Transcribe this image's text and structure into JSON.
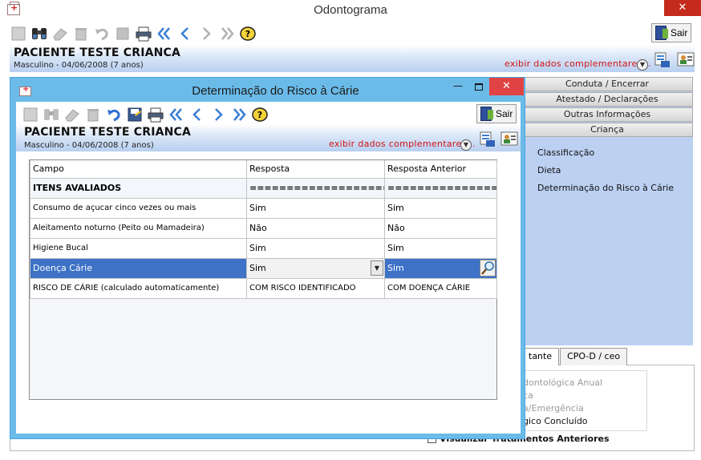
{
  "main": {
    "title": "Odontograma",
    "close_label": "✕",
    "sair_label": "Sair",
    "patient_name": "PACIENTE TESTE CRIANCA",
    "patient_info": "Masculino - 04/06/2008 (7 anos)",
    "exibir_label": "exibir dados complementares..."
  },
  "right_panel": {
    "tabs": [
      "Conduta / Encerrar",
      "Atestado / Declarações",
      "Outras Informações",
      "Criança"
    ],
    "items": [
      "Classificação",
      "Dieta",
      "Determinação do Risco à Cárie"
    ]
  },
  "bottom": {
    "tabs": [
      "tante",
      "CPO-D / ceo"
    ],
    "legend": [
      "dontológica Anual",
      "ca",
      "a/Emergência",
      "gico Concluído"
    ],
    "visualizar_label": "Visualizar Tratamentos Anteriores"
  },
  "dialog": {
    "title": "Determinação do Risco à Cárie",
    "min_label": "—",
    "close_label": "✕",
    "sair_label": "Sair",
    "patient_name": "PACIENTE TESTE CRIANCA",
    "patient_info": "Masculino - 04/06/2008 (7 anos)",
    "exibir_label": "exibir dados complementares..."
  },
  "grid": {
    "columns": [
      "Campo",
      "Resposta",
      "Resposta Anterior"
    ],
    "rows": [
      {
        "campo": "ITENS AVALIADOS",
        "resposta": "===========================",
        "anterior": "===========================",
        "type": "header"
      },
      {
        "campo": "Consumo de açucar cinco vezes ou mais",
        "resposta": "Sim",
        "anterior": "Sim",
        "type": "normal"
      },
      {
        "campo": "Aleitamento noturno (Peito ou Mamadeira)",
        "resposta": "Não",
        "anterior": "Não",
        "type": "normal"
      },
      {
        "campo": "Higiene Bucal",
        "resposta": "Sim",
        "anterior": "Sim",
        "type": "normal"
      },
      {
        "campo": "Doença Cárie",
        "resposta": "Sim",
        "anterior": "Sim",
        "type": "selected"
      },
      {
        "campo": "RISCO DE CÁRIE (calculado automaticamente)",
        "resposta": "COM RISCO IDENTIFICADO",
        "anterior": "COM DOENÇA CÁRIE",
        "type": "normal"
      }
    ]
  },
  "colors": {
    "dialog_frame": "#6bbbe9",
    "selected_row": "#3d72c7",
    "link_red": "#d21414",
    "close_red": "#e04343"
  }
}
